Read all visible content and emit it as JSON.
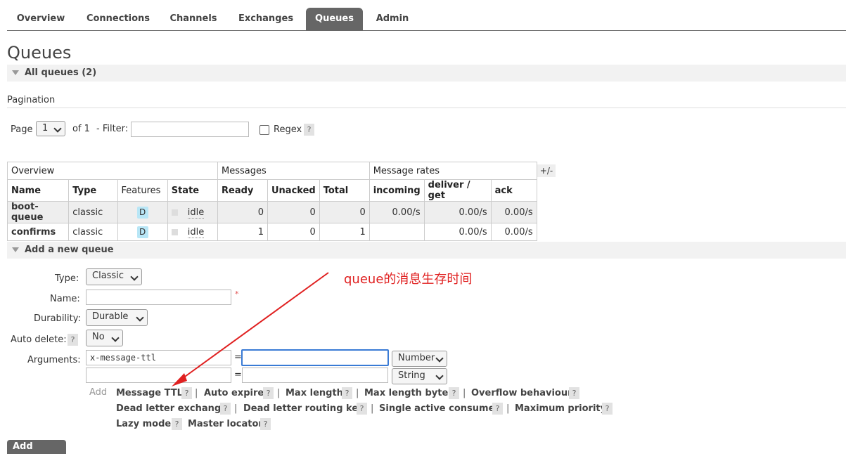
{
  "tabs": [
    "Overview",
    "Connections",
    "Channels",
    "Exchanges",
    "Queues",
    "Admin"
  ],
  "page_title": "Queues",
  "all_queues": {
    "label": "All queues (2)"
  },
  "pagination": {
    "title": "Pagination",
    "page_label": "Page",
    "page_value": "1",
    "of_label": "of 1",
    "filter_label": "- Filter:",
    "filter_value": "",
    "regex_label": "Regex",
    "help": "?"
  },
  "table": {
    "groups": [
      "Overview",
      "Messages",
      "Message rates"
    ],
    "headers": [
      "Name",
      "Type",
      "Features",
      "State",
      "Ready",
      "Unacked",
      "Total",
      "incoming",
      "deliver / get",
      "ack"
    ],
    "plusminus": "+/-",
    "rows": [
      {
        "name": "boot-queue",
        "type": "classic",
        "feature": "D",
        "state": "idle",
        "ready": "0",
        "unacked": "0",
        "total": "0",
        "incoming": "0.00/s",
        "deliver": "0.00/s",
        "ack": "0.00/s"
      },
      {
        "name": "confirms",
        "type": "classic",
        "feature": "D",
        "state": "idle",
        "ready": "1",
        "unacked": "0",
        "total": "1",
        "incoming": "",
        "deliver": "0.00/s",
        "ack": "0.00/s"
      }
    ]
  },
  "add_queue": {
    "label": "Add a new queue",
    "type_label": "Type:",
    "type_value": "Classic",
    "name_label": "Name:",
    "required_mark": "*",
    "durability_label": "Durability:",
    "durability_value": "Durable",
    "auto_delete_label": "Auto delete:",
    "auto_delete_value": "No",
    "arguments_label": "Arguments:",
    "arg1_key": "x-message-ttl",
    "arg1_value": "",
    "arg1_type": "Number",
    "arg2_key": "",
    "arg2_value": "",
    "arg2_type": "String",
    "equals": "=",
    "add_label": "Add",
    "arg_links": [
      "Message TTL",
      "Auto expire",
      "Max length",
      "Max length bytes",
      "Overflow behaviour",
      "Dead letter exchange",
      "Dead letter routing key",
      "Single active consumer",
      "Maximum priority",
      "Lazy mode",
      "Master locator"
    ],
    "separator": "|",
    "submit_label": "Add queue"
  },
  "annotation": "queue的消息生存时间",
  "colors": {
    "annotation": "#e02020",
    "active_tab": "#666666",
    "feature_badge": "#b8e6f6"
  }
}
